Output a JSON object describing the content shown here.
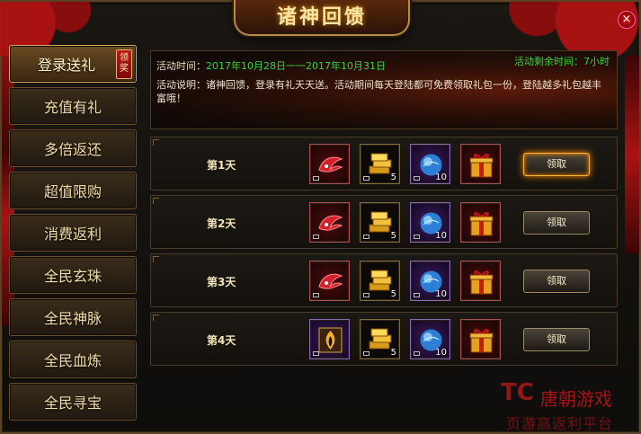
{
  "window": {
    "title": "诸神回馈",
    "close_symbol": "×"
  },
  "sidebar": {
    "items": [
      {
        "label": "登录送礼",
        "badge": "领奖",
        "active": true
      },
      {
        "label": "充值有礼"
      },
      {
        "label": "多倍返还"
      },
      {
        "label": "超值限购"
      },
      {
        "label": "消费返利"
      },
      {
        "label": "全民玄珠"
      },
      {
        "label": "全民神脉"
      },
      {
        "label": "全民血炼"
      },
      {
        "label": "全民寻宝"
      }
    ]
  },
  "info": {
    "time_label": "活动时间：",
    "time_value": "2017年10月28日一一2017年10月31日",
    "remaining": "活动剩余时间：7小时",
    "description": "活动说明：诸神回馈，登录有礼天天送。活动期间每天登陆都可免费领取礼包一份，登陆越多礼包越丰富哦！"
  },
  "rewards": {
    "claim_label": "领取",
    "rows": [
      {
        "day": "第1天",
        "items": [
          {
            "icon": "red-wing-icon",
            "count": ""
          },
          {
            "icon": "gold-ingot-icon",
            "count": "5"
          },
          {
            "icon": "blue-orb-icon",
            "count": "10"
          },
          {
            "icon": "gift-box-icon",
            "count": ""
          }
        ],
        "claimable": true
      },
      {
        "day": "第2天",
        "items": [
          {
            "icon": "red-wing-icon",
            "count": ""
          },
          {
            "icon": "gold-ingot-icon",
            "count": "5"
          },
          {
            "icon": "blue-orb-icon",
            "count": "10"
          },
          {
            "icon": "gift-box-icon",
            "count": ""
          }
        ],
        "claimable": false
      },
      {
        "day": "第3天",
        "items": [
          {
            "icon": "red-wing-icon",
            "count": ""
          },
          {
            "icon": "gold-ingot-icon",
            "count": "5"
          },
          {
            "icon": "blue-orb-icon",
            "count": "10"
          },
          {
            "icon": "gift-box-icon",
            "count": ""
          }
        ],
        "claimable": false
      },
      {
        "day": "第4天",
        "items": [
          {
            "icon": "flame-portrait-icon",
            "count": ""
          },
          {
            "icon": "gold-ingot-icon",
            "count": "5"
          },
          {
            "icon": "blue-orb-icon",
            "count": "10"
          },
          {
            "icon": "gift-box-icon",
            "count": ""
          }
        ],
        "claimable": false
      }
    ]
  },
  "watermark": {
    "logo": "TC",
    "name": "唐朝游戏",
    "subtitle": "页游高返利平台"
  },
  "colors": {
    "accent_green": "#39d23a",
    "frame_gold": "#b58a45",
    "ribbon_red": "#b01212"
  }
}
